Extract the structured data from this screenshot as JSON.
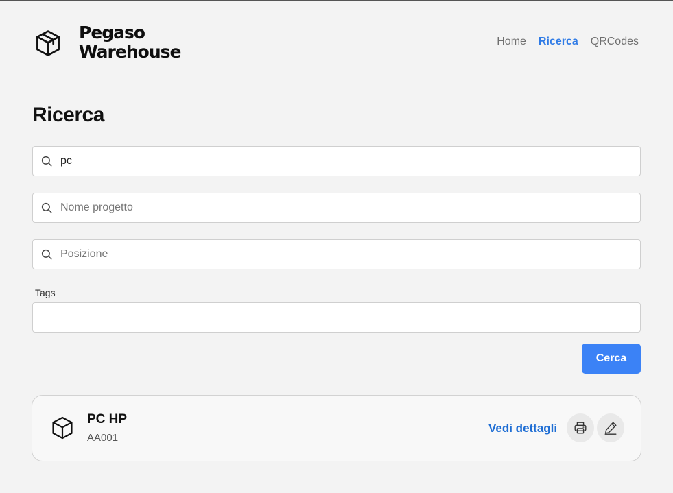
{
  "brand": {
    "line1": "Pegaso",
    "line2": "Warehouse",
    "icon": "package-icon"
  },
  "nav": {
    "home": "Home",
    "search": "Ricerca",
    "qrcodes": "QRCodes"
  },
  "page": {
    "title": "Ricerca"
  },
  "form": {
    "query": {
      "value": "pc",
      "placeholder": "",
      "icon": "search-icon"
    },
    "project": {
      "value": "",
      "placeholder": "Nome progetto",
      "icon": "search-icon"
    },
    "position": {
      "value": "",
      "placeholder": "Posizione",
      "icon": "search-icon"
    },
    "tags_label": "Tags",
    "tags_value": "",
    "submit_label": "Cerca"
  },
  "results": [
    {
      "name": "PC HP",
      "code": "AA001",
      "details_label": "Vedi dettagli",
      "icon": "package-icon"
    }
  ],
  "colors": {
    "accent": "#3b82f6",
    "link": "#1f6ed4",
    "background": "#f3f3f3"
  }
}
